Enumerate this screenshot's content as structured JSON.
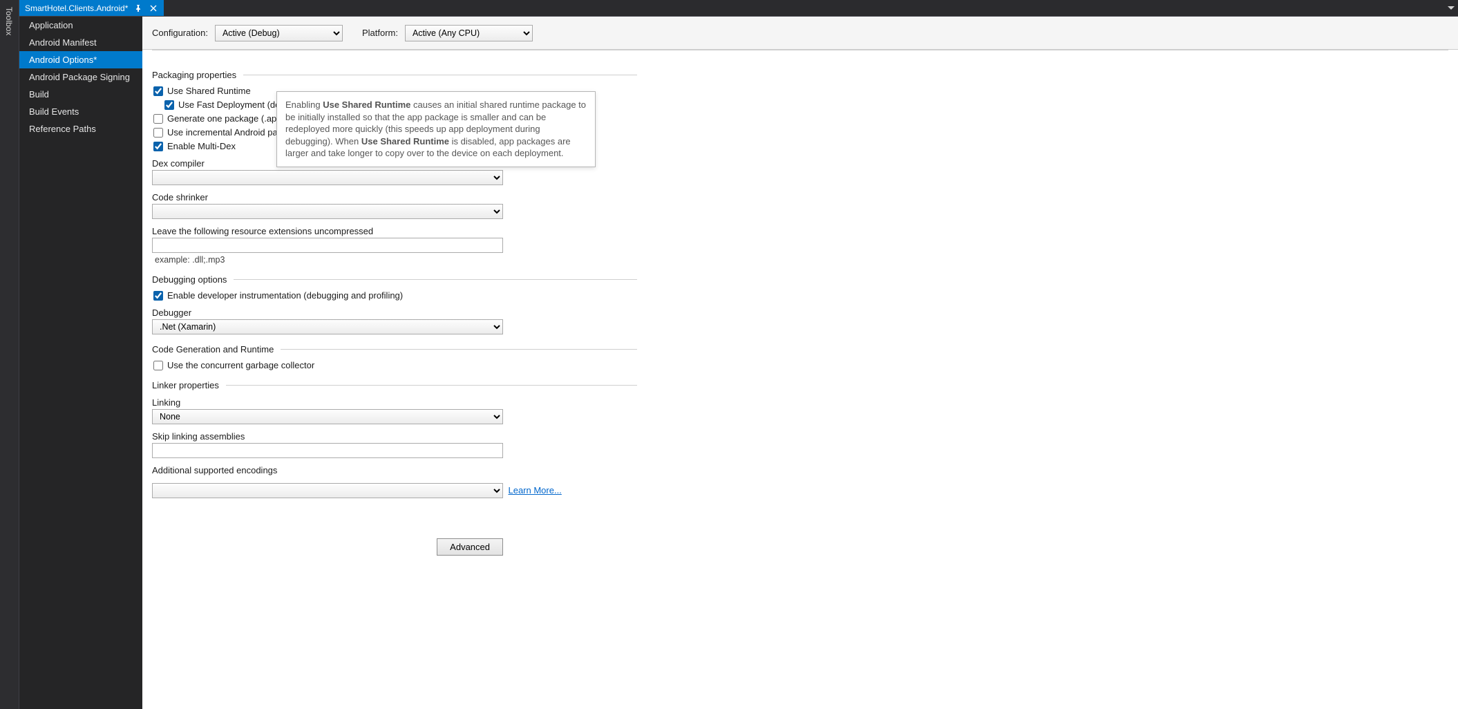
{
  "toolbox": {
    "label": "Toolbox"
  },
  "tab": {
    "title": "SmartHotel.Clients.Android*"
  },
  "sidebar": {
    "items": [
      {
        "label": "Application",
        "selected": false
      },
      {
        "label": "Android Manifest",
        "selected": false
      },
      {
        "label": "Android Options*",
        "selected": true
      },
      {
        "label": "Android Package Signing",
        "selected": false
      },
      {
        "label": "Build",
        "selected": false
      },
      {
        "label": "Build Events",
        "selected": false
      },
      {
        "label": "Reference Paths",
        "selected": false
      }
    ]
  },
  "config": {
    "configuration_label": "Configuration:",
    "configuration_value": "Active (Debug)",
    "platform_label": "Platform:",
    "platform_value": "Active (Any CPU)"
  },
  "packaging": {
    "section": "Packaging properties",
    "use_shared_runtime": {
      "label": "Use Shared Runtime",
      "checked": true
    },
    "use_fast_deployment": {
      "label": "Use Fast Deployment (debug mode only)",
      "checked": true
    },
    "generate_one_apk": {
      "label": "Generate one package (.apk) per selected ABI",
      "checked": false
    },
    "use_incremental_packaging": {
      "label": "Use incremental Android packaging system (aapt2)",
      "checked": false
    },
    "enable_multidex": {
      "label": "Enable Multi-Dex",
      "checked": true
    },
    "dex_compiler_label": "Dex compiler",
    "dex_compiler_value": "",
    "code_shrinker_label": "Code shrinker",
    "code_shrinker_value": "",
    "uncompressed_label": "Leave the following resource extensions uncompressed",
    "uncompressed_value": "",
    "uncompressed_hint": "example: .dll;.mp3"
  },
  "debugging": {
    "section": "Debugging options",
    "enable_dev_instr": {
      "label": "Enable developer instrumentation (debugging and profiling)",
      "checked": true
    },
    "debugger_label": "Debugger",
    "debugger_value": ".Net (Xamarin)"
  },
  "codegen": {
    "section": "Code Generation and Runtime",
    "concurrent_gc": {
      "label": "Use the concurrent garbage collector",
      "checked": false
    }
  },
  "linker": {
    "section": "Linker properties",
    "linking_label": "Linking",
    "linking_value": "None",
    "skip_label": "Skip linking assemblies",
    "skip_value": "",
    "encodings_label": "Additional supported encodings",
    "encodings_value": "",
    "learn_more": "Learn More...",
    "advanced": "Advanced"
  },
  "tooltip": {
    "t1": "Enabling ",
    "b1": "Use Shared Runtime",
    "t2": " causes an initial shared runtime package to be initially installed so that the app package is smaller and can be redeployed more quickly (this speeds up app deployment during debugging). When ",
    "b2": "Use Shared Runtime",
    "t3": " is disabled, app packages are larger and take longer to copy over to the device on each deployment."
  }
}
